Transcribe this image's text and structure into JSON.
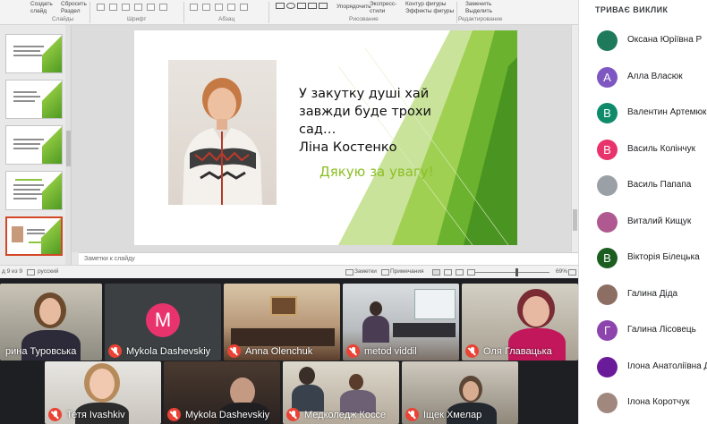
{
  "ribbon": {
    "items": [
      "Создать",
      "слайд",
      "Сбросить",
      "Раздел",
      "Упорядочить",
      "Экспресс-",
      "стили",
      "Контур фигуры",
      "Эффекты фигуры",
      "Заменить",
      "Выделить"
    ],
    "groups": [
      "Слайды",
      "Шрифт",
      "Абзац",
      "Рисование",
      "Редактирование"
    ]
  },
  "slide": {
    "quote_line1": "У закутку душі хай",
    "quote_line2": "завжди буде трохи сад…",
    "quote_line3": "Ліна Костенко",
    "thanks": "Дякую за увагу!",
    "accent_color": "#8cbf26"
  },
  "notes": {
    "placeholder": "Заметки к слайду"
  },
  "status": {
    "slide_counter": "д 9 из 9",
    "language": "русский",
    "notes_label": "Заметки",
    "comments_label": "Примечания",
    "zoom": "69%"
  },
  "video": {
    "tiles": [
      {
        "name": "рина Туровська",
        "muted": false,
        "avatar_letter": "",
        "avatar_color": ""
      },
      {
        "name": "Mykola Dashevskiy",
        "muted": true,
        "avatar_letter": "M",
        "avatar_color": "#e8336d"
      },
      {
        "name": "Anna Olenchuk",
        "muted": true,
        "avatar_letter": "",
        "avatar_color": ""
      },
      {
        "name": "metod viddil",
        "muted": true,
        "avatar_letter": "",
        "avatar_color": ""
      },
      {
        "name": "Оля Главацька",
        "muted": true,
        "avatar_letter": "",
        "avatar_color": ""
      },
      {
        "name": "Тетя Ivashkiv",
        "muted": true,
        "avatar_letter": "",
        "avatar_color": ""
      },
      {
        "name": "Mykola Dashevskiy",
        "muted": true,
        "avatar_letter": "",
        "avatar_color": ""
      },
      {
        "name": "Медколедж Коссе",
        "muted": true,
        "avatar_letter": "",
        "avatar_color": ""
      },
      {
        "name": "Іщек Хмелар",
        "muted": true,
        "avatar_letter": "",
        "avatar_color": ""
      }
    ]
  },
  "panel": {
    "title": "ТРИВАЄ ВИКЛИК",
    "participants": [
      {
        "name": "Оксана Юріївна Р",
        "letter": "",
        "color": "#1e7a5a"
      },
      {
        "name": "Алла Власюк",
        "letter": "А",
        "color": "#7e57c2"
      },
      {
        "name": "Валентин Артемюк",
        "letter": "В",
        "color": "#0f8a6a"
      },
      {
        "name": "Василь Колінчук",
        "letter": "В",
        "color": "#e8336d"
      },
      {
        "name": "Василь Папапа",
        "letter": "",
        "color": "#9aa0a6"
      },
      {
        "name": "Виталий Кищук",
        "letter": "",
        "color": "#b05890"
      },
      {
        "name": "Вікторія Білецька",
        "letter": "В",
        "color": "#1b5e20"
      },
      {
        "name": "Галина Діда",
        "letter": "",
        "color": "#8d6e63"
      },
      {
        "name": "Галина Лісовець",
        "letter": "Г",
        "color": "#8e44ad"
      },
      {
        "name": "Ілона Анатоліївна Д",
        "letter": "",
        "color": "#6a1b9a"
      },
      {
        "name": "Ілона Коротчук",
        "letter": "",
        "color": "#a1887f"
      }
    ]
  }
}
